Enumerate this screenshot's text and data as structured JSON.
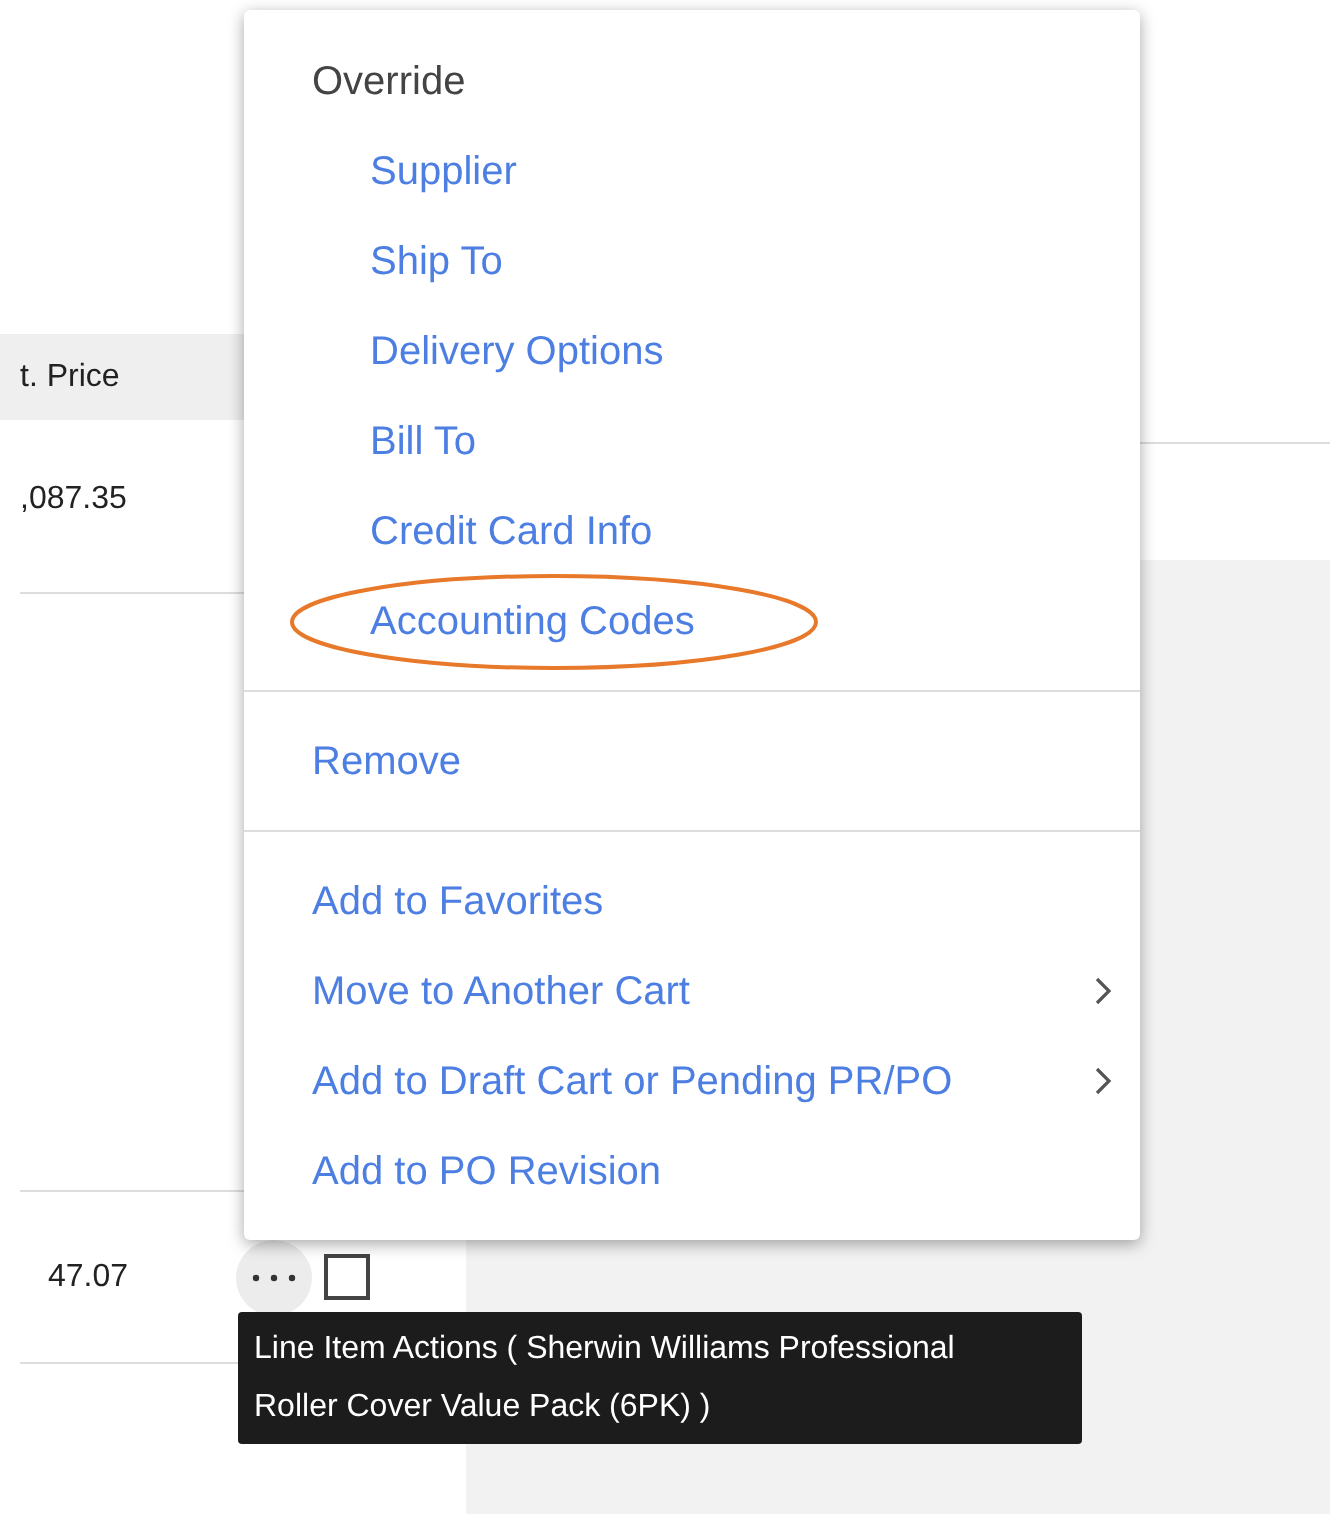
{
  "table": {
    "columns": [
      {
        "label": "t. Price"
      }
    ],
    "rows": [
      {
        "price": ",087.35"
      },
      {
        "price": "47.07",
        "checked": false
      }
    ]
  },
  "menu": {
    "sections": [
      {
        "heading": "Override",
        "items": [
          {
            "label": "Supplier",
            "circled": false,
            "submenu": false
          },
          {
            "label": "Ship To",
            "circled": false,
            "submenu": false
          },
          {
            "label": "Delivery Options",
            "circled": false,
            "submenu": false
          },
          {
            "label": "Bill To",
            "circled": false,
            "submenu": false
          },
          {
            "label": "Credit Card Info",
            "circled": false,
            "submenu": false
          },
          {
            "label": "Accounting Codes",
            "circled": true,
            "submenu": false
          }
        ]
      },
      {
        "items": [
          {
            "label": "Remove",
            "circled": false,
            "submenu": false
          }
        ]
      },
      {
        "items": [
          {
            "label": "Add to Favorites",
            "circled": false,
            "submenu": false
          },
          {
            "label": "Move to Another Cart",
            "circled": false,
            "submenu": true
          },
          {
            "label": "Add to Draft Cart or Pending PR/PO",
            "circled": false,
            "submenu": true
          },
          {
            "label": "Add to PO Revision",
            "circled": false,
            "submenu": false
          }
        ]
      }
    ]
  },
  "tooltip": {
    "text": "Line Item Actions ( Sherwin Williams Professional Roller Cover Value Pack (6PK) )"
  }
}
